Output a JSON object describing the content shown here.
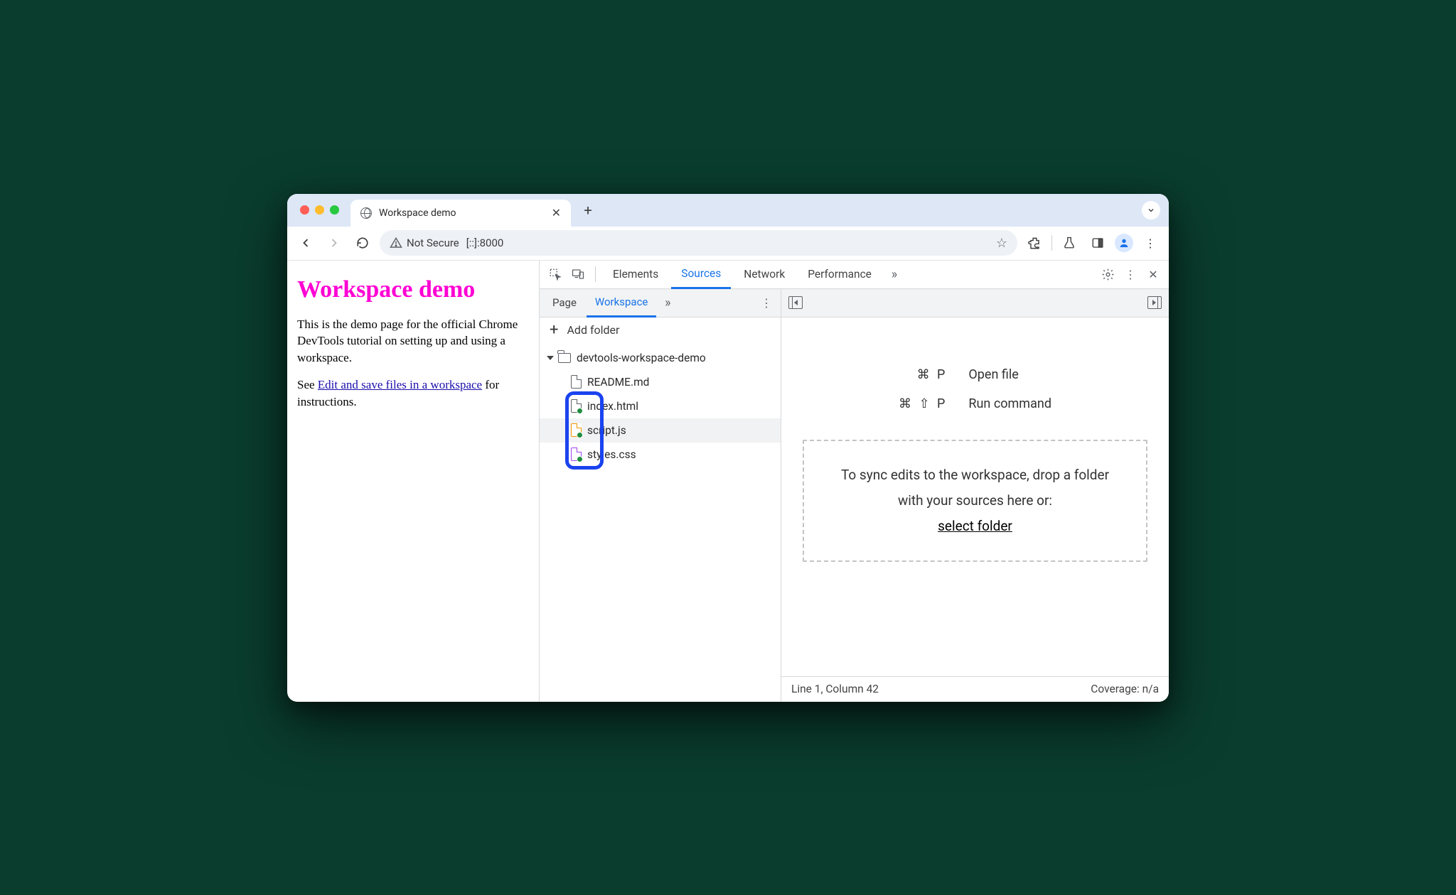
{
  "browser": {
    "tab_title": "Workspace demo",
    "addr_security": "Not Secure",
    "url": "[::]:8000"
  },
  "page": {
    "heading": "Workspace demo",
    "p1": "This is the demo page for the official Chrome DevTools tutorial on setting up and using a workspace.",
    "p2a": "See ",
    "link": "Edit and save files in a workspace",
    "p2b": " for instructions."
  },
  "devtools": {
    "tabs": {
      "elements": "Elements",
      "sources": "Sources",
      "network": "Network",
      "performance": "Performance"
    },
    "sources": {
      "tabs": {
        "page": "Page",
        "workspace": "Workspace"
      },
      "add_folder": "Add folder",
      "folder": "devtools-workspace-demo",
      "files": {
        "readme": "README.md",
        "index": "index.html",
        "script": "script.js",
        "styles": "styles.css"
      }
    },
    "editor": {
      "shortcut1_keys": "⌘ P",
      "shortcut1_label": "Open file",
      "shortcut2_keys": "⌘ ⇧ P",
      "shortcut2_label": "Run command",
      "drop_text": "To sync edits to the workspace, drop a folder with your sources here or:",
      "select_folder": "select folder",
      "status_left": "Line 1, Column 42",
      "status_right": "Coverage: n/a"
    }
  }
}
